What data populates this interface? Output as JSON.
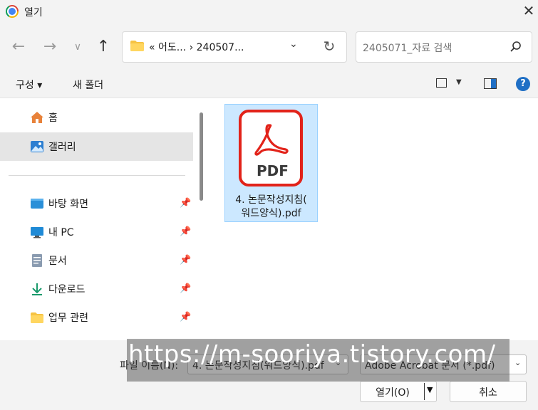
{
  "window": {
    "title": "열기",
    "close_icon": "close-icon"
  },
  "nav": {
    "address_text": "« 어도... › 240507...",
    "search_placeholder": "2405071_자료 검색"
  },
  "commands": {
    "organize": "구성 ▾",
    "new_folder": "새 폴더"
  },
  "sidebar": {
    "items": [
      {
        "label": "홈",
        "icon": "home-icon"
      },
      {
        "label": "갤러리",
        "icon": "gallery-icon",
        "selected": true
      },
      {
        "label": "바탕 화면",
        "icon": "desktop-icon",
        "pinned": true
      },
      {
        "label": "내 PC",
        "icon": "pc-icon",
        "pinned": true
      },
      {
        "label": "문서",
        "icon": "documents-icon",
        "pinned": true
      },
      {
        "label": "다운로드",
        "icon": "download-icon",
        "pinned": true
      },
      {
        "label": "업무 관련",
        "icon": "folder-icon",
        "pinned": true
      }
    ]
  },
  "files": [
    {
      "name_line1": "4. 논문작성지침(",
      "name_line2": "워드양식).pdf",
      "icon_text": "PDF"
    }
  ],
  "bottom": {
    "filename_label": "파일 이름(N):",
    "filename_value": "4. 논문작성지침(워드양식).pdf",
    "type_value": "Adobe Acrobat 문서 (*.pdf)",
    "open_label": "열기(O)",
    "cancel_label": "취소"
  },
  "watermark": "https://m-sooriya.tistory.com/",
  "colors": {
    "accent": "#1f6fc5",
    "pdf_red": "#e2231a",
    "selection": "#cce8ff"
  }
}
